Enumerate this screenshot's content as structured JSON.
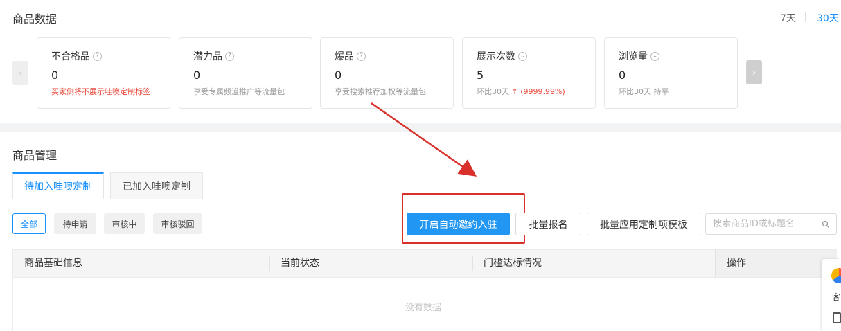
{
  "header": {
    "title": "商品数据",
    "range_7": "7天",
    "range_30": "30天"
  },
  "cards": [
    {
      "label": "不合格品",
      "value": "0",
      "desc": "买家侧将不展示哇噢定制标签"
    },
    {
      "label": "潜力品",
      "value": "0",
      "desc": "享受专属频道推广等流量包"
    },
    {
      "label": "爆品",
      "value": "0",
      "desc": "享受搜索推荐加权等流量包"
    },
    {
      "label": "展示次数",
      "value": "5",
      "desc_prefix": "环比30天",
      "desc_change": "↑ (9999.99%)"
    },
    {
      "label": "浏览量",
      "value": "0",
      "desc": "环比30天 持平"
    }
  ],
  "management": {
    "title": "商品管理",
    "tabs": [
      "待加入哇噢定制",
      "已加入哇噢定制"
    ],
    "filters": [
      "全部",
      "待申请",
      "审核中",
      "审核驳回"
    ],
    "buttons": {
      "auto_invite": "开启自动邀约入驻",
      "batch_signup": "批量报名",
      "batch_template": "批量应用定制项模板"
    },
    "search_placeholder": "搜索商品ID或标题名"
  },
  "table": {
    "columns": [
      "商品基础信息",
      "当前状态",
      "门槛达标情况",
      "操作"
    ],
    "empty_text": "没有数据"
  },
  "float_panel": {
    "label": "客"
  },
  "colors": {
    "accent": "#1890ff",
    "primary_button": "#2196f3",
    "highlight": "#d9302c",
    "warning": "#e8483a"
  }
}
